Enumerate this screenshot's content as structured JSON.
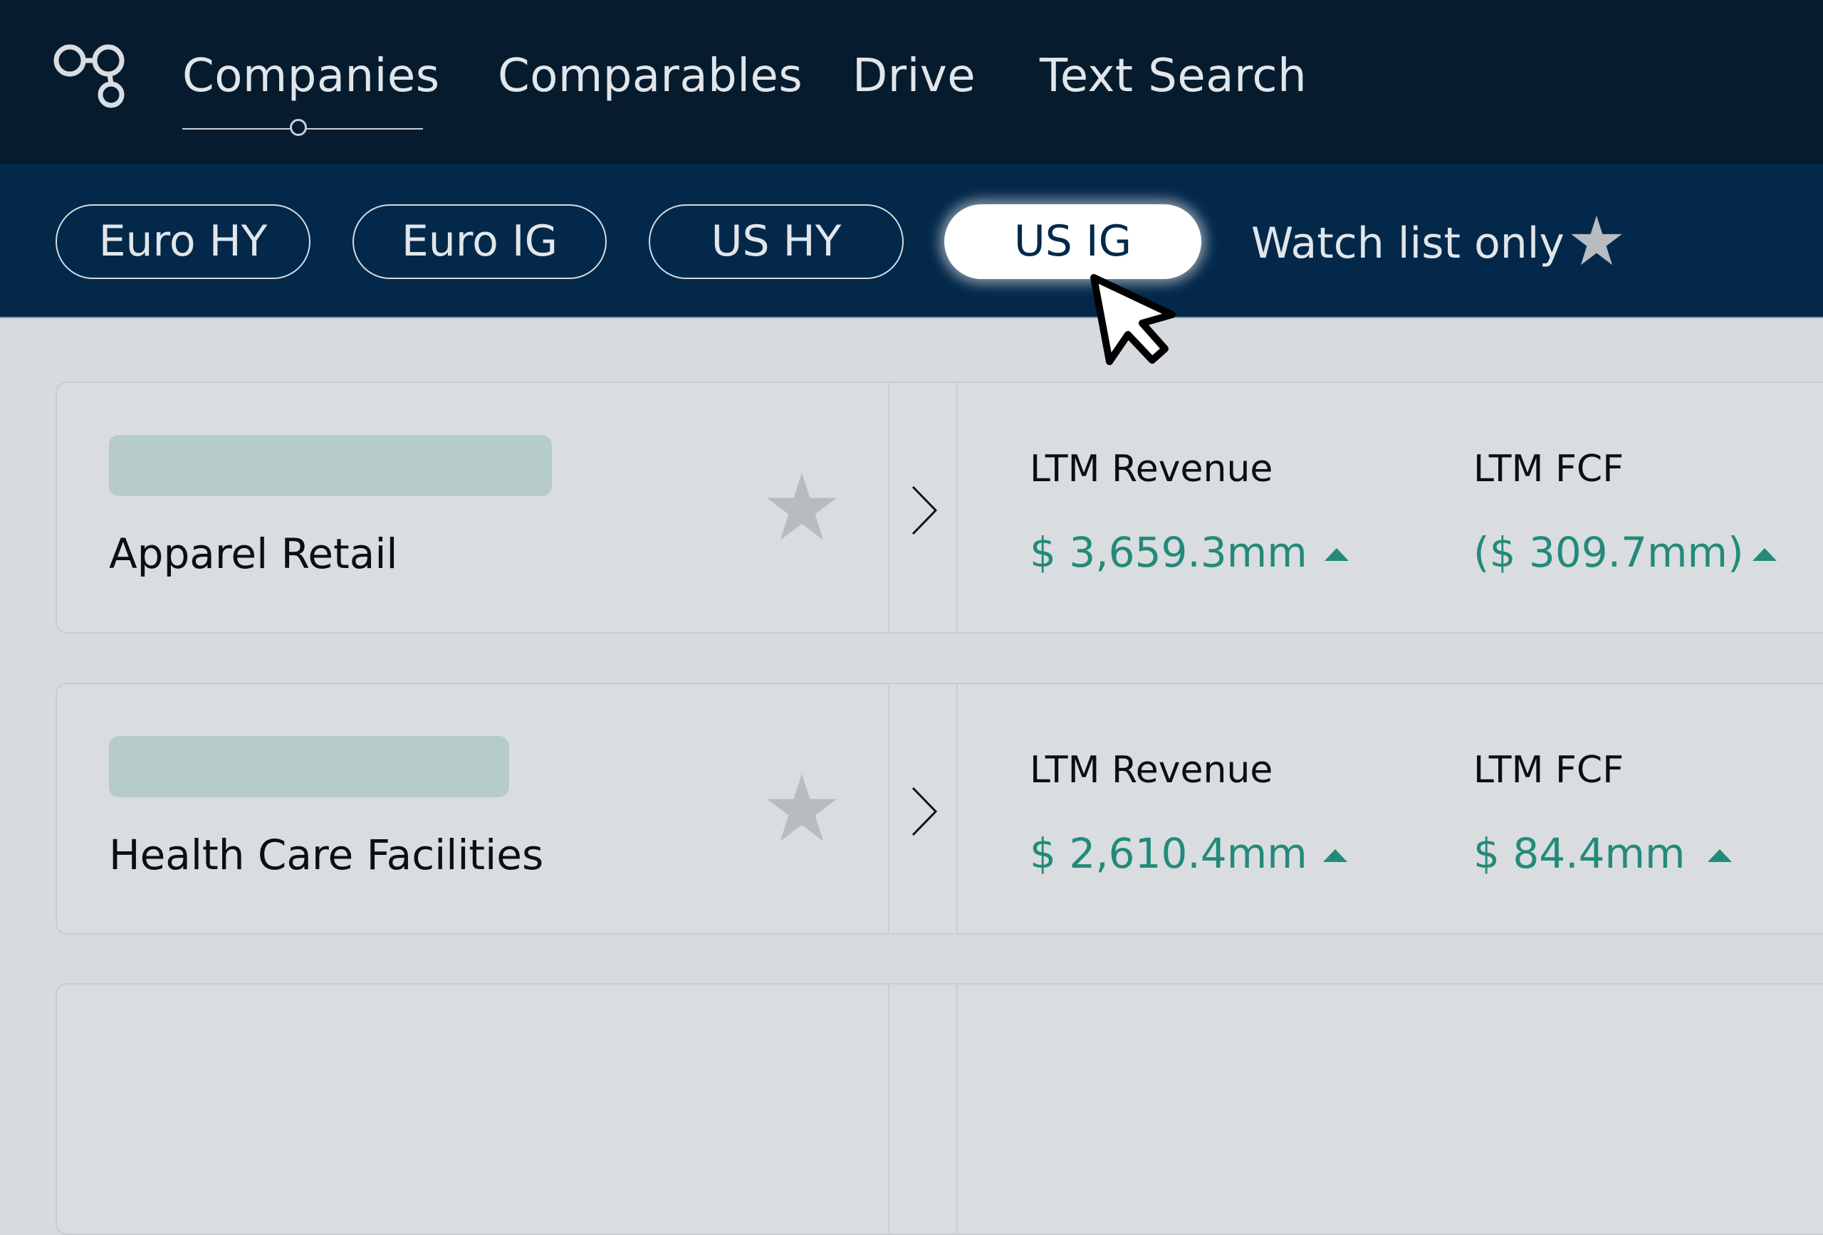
{
  "nav": {
    "logo_icon": "connected-circles-logo-icon",
    "items": [
      {
        "label": "Companies",
        "active": true
      },
      {
        "label": "Comparables",
        "active": false
      },
      {
        "label": "Drive",
        "active": false
      },
      {
        "label": "Text Search",
        "active": false
      }
    ]
  },
  "filters": {
    "pills": [
      {
        "label": "Euro HY",
        "active": false
      },
      {
        "label": "Euro IG",
        "active": false
      },
      {
        "label": "US HY",
        "active": false
      },
      {
        "label": "US IG",
        "active": true
      }
    ],
    "watch_list_label": "Watch list only",
    "watch_list_icon": "star-icon"
  },
  "companies": [
    {
      "name": "Apparel Retail",
      "metrics": [
        {
          "label": "LTM Revenue",
          "value": "$ 3,659.3mm",
          "trend": "up"
        },
        {
          "label": "LTM FCF",
          "value": "($ 309.7mm)",
          "trend": "up"
        }
      ]
    },
    {
      "name": "Health Care Facilities",
      "metrics": [
        {
          "label": "LTM Revenue",
          "value": "$ 2,610.4mm",
          "trend": "up"
        },
        {
          "label": "LTM FCF",
          "value": "$ 84.4mm",
          "trend": "up"
        }
      ]
    }
  ],
  "colors": {
    "nav_bg": "#061C2E",
    "filter_bg": "#03284A",
    "content_bg": "#D7DBDF",
    "positive": "#238A7A",
    "logo_placeholder": "#B5CCCA"
  }
}
